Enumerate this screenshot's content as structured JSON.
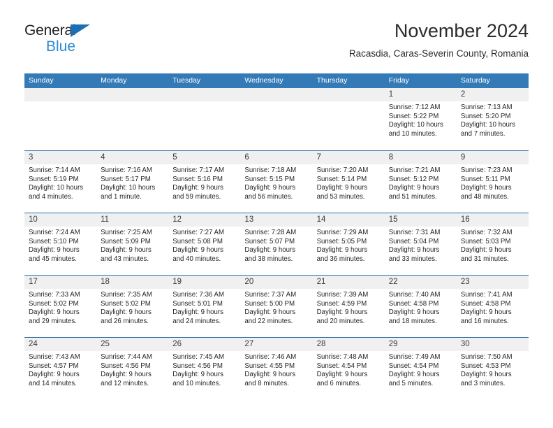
{
  "brand": {
    "name_part1": "General",
    "name_part2": "Blue",
    "triangle_icon": "triangle-icon",
    "colors": {
      "dark": "#231f20",
      "blue": "#2a8ad4",
      "triangle": "#1a6fb5"
    }
  },
  "header": {
    "month_title": "November 2024",
    "location": "Racasdia, Caras-Severin County, Romania"
  },
  "calendar": {
    "accent_color": "#337ab7",
    "row_divider_color": "#2f6fa8",
    "date_band_color": "#f0f0f0",
    "day_names": [
      "Sunday",
      "Monday",
      "Tuesday",
      "Wednesday",
      "Thursday",
      "Friday",
      "Saturday"
    ],
    "weeks": [
      [
        {
          "date": "",
          "empty": true
        },
        {
          "date": "",
          "empty": true
        },
        {
          "date": "",
          "empty": true
        },
        {
          "date": "",
          "empty": true
        },
        {
          "date": "",
          "empty": true
        },
        {
          "date": "1",
          "sunrise": "Sunrise: 7:12 AM",
          "sunset": "Sunset: 5:22 PM",
          "daylight_line1": "Daylight: 10 hours",
          "daylight_line2": "and 10 minutes."
        },
        {
          "date": "2",
          "sunrise": "Sunrise: 7:13 AM",
          "sunset": "Sunset: 5:20 PM",
          "daylight_line1": "Daylight: 10 hours",
          "daylight_line2": "and 7 minutes."
        }
      ],
      [
        {
          "date": "3",
          "sunrise": "Sunrise: 7:14 AM",
          "sunset": "Sunset: 5:19 PM",
          "daylight_line1": "Daylight: 10 hours",
          "daylight_line2": "and 4 minutes."
        },
        {
          "date": "4",
          "sunrise": "Sunrise: 7:16 AM",
          "sunset": "Sunset: 5:17 PM",
          "daylight_line1": "Daylight: 10 hours",
          "daylight_line2": "and 1 minute."
        },
        {
          "date": "5",
          "sunrise": "Sunrise: 7:17 AM",
          "sunset": "Sunset: 5:16 PM",
          "daylight_line1": "Daylight: 9 hours",
          "daylight_line2": "and 59 minutes."
        },
        {
          "date": "6",
          "sunrise": "Sunrise: 7:18 AM",
          "sunset": "Sunset: 5:15 PM",
          "daylight_line1": "Daylight: 9 hours",
          "daylight_line2": "and 56 minutes."
        },
        {
          "date": "7",
          "sunrise": "Sunrise: 7:20 AM",
          "sunset": "Sunset: 5:14 PM",
          "daylight_line1": "Daylight: 9 hours",
          "daylight_line2": "and 53 minutes."
        },
        {
          "date": "8",
          "sunrise": "Sunrise: 7:21 AM",
          "sunset": "Sunset: 5:12 PM",
          "daylight_line1": "Daylight: 9 hours",
          "daylight_line2": "and 51 minutes."
        },
        {
          "date": "9",
          "sunrise": "Sunrise: 7:23 AM",
          "sunset": "Sunset: 5:11 PM",
          "daylight_line1": "Daylight: 9 hours",
          "daylight_line2": "and 48 minutes."
        }
      ],
      [
        {
          "date": "10",
          "sunrise": "Sunrise: 7:24 AM",
          "sunset": "Sunset: 5:10 PM",
          "daylight_line1": "Daylight: 9 hours",
          "daylight_line2": "and 45 minutes."
        },
        {
          "date": "11",
          "sunrise": "Sunrise: 7:25 AM",
          "sunset": "Sunset: 5:09 PM",
          "daylight_line1": "Daylight: 9 hours",
          "daylight_line2": "and 43 minutes."
        },
        {
          "date": "12",
          "sunrise": "Sunrise: 7:27 AM",
          "sunset": "Sunset: 5:08 PM",
          "daylight_line1": "Daylight: 9 hours",
          "daylight_line2": "and 40 minutes."
        },
        {
          "date": "13",
          "sunrise": "Sunrise: 7:28 AM",
          "sunset": "Sunset: 5:07 PM",
          "daylight_line1": "Daylight: 9 hours",
          "daylight_line2": "and 38 minutes."
        },
        {
          "date": "14",
          "sunrise": "Sunrise: 7:29 AM",
          "sunset": "Sunset: 5:05 PM",
          "daylight_line1": "Daylight: 9 hours",
          "daylight_line2": "and 36 minutes."
        },
        {
          "date": "15",
          "sunrise": "Sunrise: 7:31 AM",
          "sunset": "Sunset: 5:04 PM",
          "daylight_line1": "Daylight: 9 hours",
          "daylight_line2": "and 33 minutes."
        },
        {
          "date": "16",
          "sunrise": "Sunrise: 7:32 AM",
          "sunset": "Sunset: 5:03 PM",
          "daylight_line1": "Daylight: 9 hours",
          "daylight_line2": "and 31 minutes."
        }
      ],
      [
        {
          "date": "17",
          "sunrise": "Sunrise: 7:33 AM",
          "sunset": "Sunset: 5:02 PM",
          "daylight_line1": "Daylight: 9 hours",
          "daylight_line2": "and 29 minutes."
        },
        {
          "date": "18",
          "sunrise": "Sunrise: 7:35 AM",
          "sunset": "Sunset: 5:02 PM",
          "daylight_line1": "Daylight: 9 hours",
          "daylight_line2": "and 26 minutes."
        },
        {
          "date": "19",
          "sunrise": "Sunrise: 7:36 AM",
          "sunset": "Sunset: 5:01 PM",
          "daylight_line1": "Daylight: 9 hours",
          "daylight_line2": "and 24 minutes."
        },
        {
          "date": "20",
          "sunrise": "Sunrise: 7:37 AM",
          "sunset": "Sunset: 5:00 PM",
          "daylight_line1": "Daylight: 9 hours",
          "daylight_line2": "and 22 minutes."
        },
        {
          "date": "21",
          "sunrise": "Sunrise: 7:39 AM",
          "sunset": "Sunset: 4:59 PM",
          "daylight_line1": "Daylight: 9 hours",
          "daylight_line2": "and 20 minutes."
        },
        {
          "date": "22",
          "sunrise": "Sunrise: 7:40 AM",
          "sunset": "Sunset: 4:58 PM",
          "daylight_line1": "Daylight: 9 hours",
          "daylight_line2": "and 18 minutes."
        },
        {
          "date": "23",
          "sunrise": "Sunrise: 7:41 AM",
          "sunset": "Sunset: 4:58 PM",
          "daylight_line1": "Daylight: 9 hours",
          "daylight_line2": "and 16 minutes."
        }
      ],
      [
        {
          "date": "24",
          "sunrise": "Sunrise: 7:43 AM",
          "sunset": "Sunset: 4:57 PM",
          "daylight_line1": "Daylight: 9 hours",
          "daylight_line2": "and 14 minutes."
        },
        {
          "date": "25",
          "sunrise": "Sunrise: 7:44 AM",
          "sunset": "Sunset: 4:56 PM",
          "daylight_line1": "Daylight: 9 hours",
          "daylight_line2": "and 12 minutes."
        },
        {
          "date": "26",
          "sunrise": "Sunrise: 7:45 AM",
          "sunset": "Sunset: 4:56 PM",
          "daylight_line1": "Daylight: 9 hours",
          "daylight_line2": "and 10 minutes."
        },
        {
          "date": "27",
          "sunrise": "Sunrise: 7:46 AM",
          "sunset": "Sunset: 4:55 PM",
          "daylight_line1": "Daylight: 9 hours",
          "daylight_line2": "and 8 minutes."
        },
        {
          "date": "28",
          "sunrise": "Sunrise: 7:48 AM",
          "sunset": "Sunset: 4:54 PM",
          "daylight_line1": "Daylight: 9 hours",
          "daylight_line2": "and 6 minutes."
        },
        {
          "date": "29",
          "sunrise": "Sunrise: 7:49 AM",
          "sunset": "Sunset: 4:54 PM",
          "daylight_line1": "Daylight: 9 hours",
          "daylight_line2": "and 5 minutes."
        },
        {
          "date": "30",
          "sunrise": "Sunrise: 7:50 AM",
          "sunset": "Sunset: 4:53 PM",
          "daylight_line1": "Daylight: 9 hours",
          "daylight_line2": "and 3 minutes."
        }
      ]
    ]
  }
}
